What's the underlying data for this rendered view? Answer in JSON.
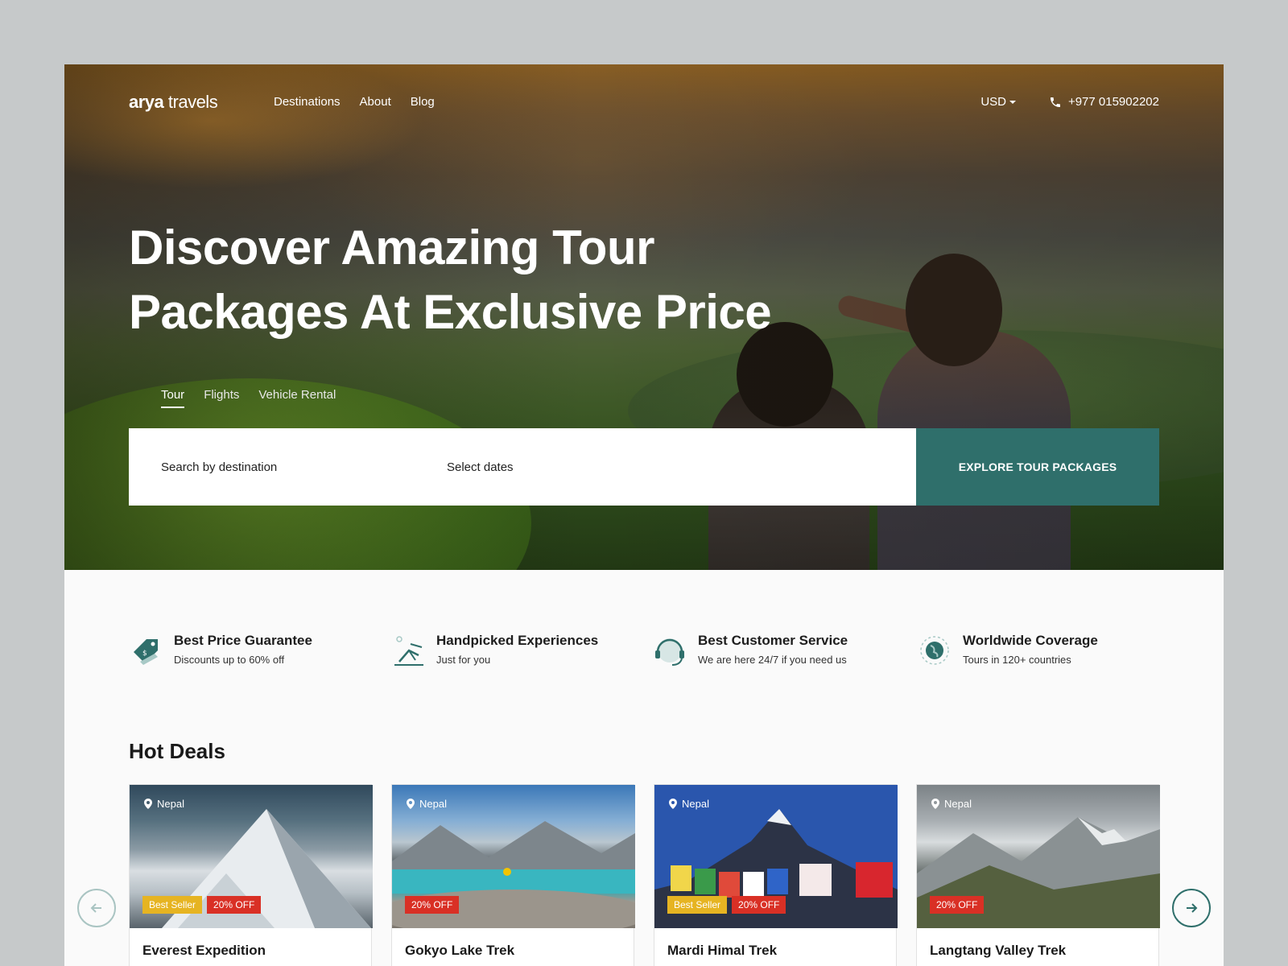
{
  "brand": {
    "logo_bold": "arya",
    "logo_light": " travels"
  },
  "nav": {
    "links": [
      "Destinations",
      "About",
      "Blog"
    ],
    "currency": "USD",
    "phone": "+977 015902202"
  },
  "hero": {
    "headline_line1": "Discover Amazing Tour",
    "headline_line2": "Packages At Exclusive Price",
    "tabs": [
      "Tour",
      "Flights",
      "Vehicle Rental"
    ],
    "active_tab": "Tour",
    "search": {
      "destination_placeholder": "Search by destination",
      "dates_placeholder": "Select dates",
      "button_label": "EXPLORE TOUR PACKAGES"
    }
  },
  "features": [
    {
      "title": "Best Price Guarantee",
      "subtitle": "Discounts up to 60% off",
      "icon": "price-tag-icon"
    },
    {
      "title": "Handpicked Experiences",
      "subtitle": "Just for you",
      "icon": "beach-chair-icon"
    },
    {
      "title": "Best Customer Service",
      "subtitle": "We are here 24/7 if you need us",
      "icon": "headset-icon"
    },
    {
      "title": "Worldwide Coverage",
      "subtitle": "Tours in 120+ countries",
      "icon": "globe-icon"
    }
  ],
  "hot_deals": {
    "title": "Hot Deals",
    "cards": [
      {
        "location": "Nepal",
        "title": "Everest Expedition",
        "badges": [
          "Best Seller",
          "20% OFF"
        ]
      },
      {
        "location": "Nepal",
        "title": "Gokyo Lake Trek",
        "badges": [
          "20% OFF"
        ]
      },
      {
        "location": "Nepal",
        "title": "Mardi Himal Trek",
        "badges": [
          "Best Seller",
          "20% OFF"
        ]
      },
      {
        "location": "Nepal",
        "title": "Langtang Valley Trek",
        "badges": [
          "20% OFF"
        ]
      }
    ]
  },
  "colors": {
    "accent": "#2f6f6b",
    "best_seller": "#e6b422",
    "discount": "#d93025",
    "page_bg": "#c6c9ca"
  }
}
